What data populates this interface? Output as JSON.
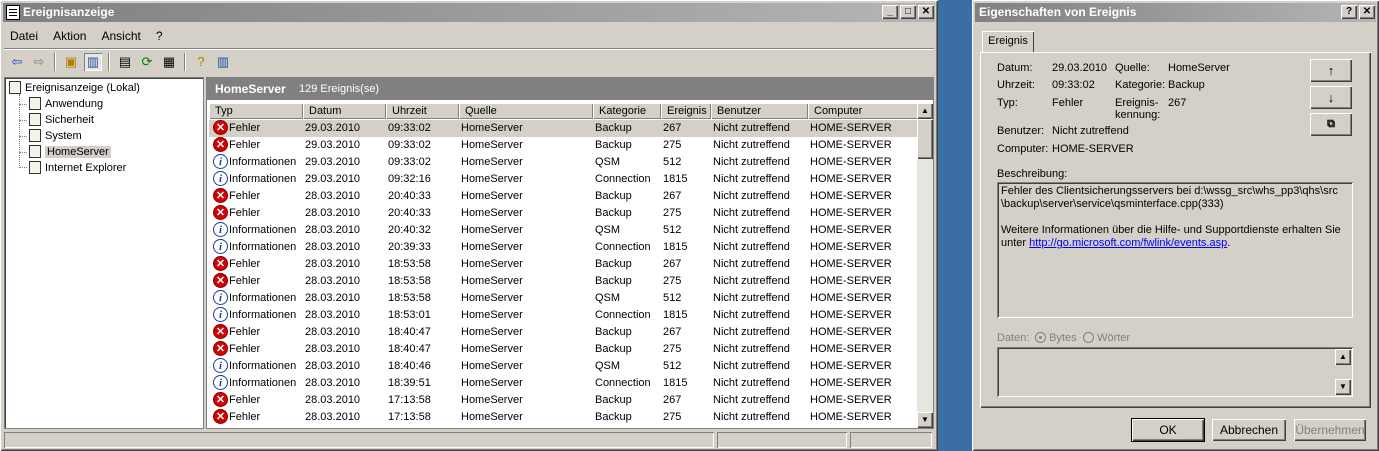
{
  "main": {
    "title": "Ereignisanzeige",
    "menu": [
      "Datei",
      "Aktion",
      "Ansicht",
      "?"
    ],
    "tree": {
      "root": "Ereignisanzeige (Lokal)",
      "items": [
        "Anwendung",
        "Sicherheit",
        "System",
        "HomeServer",
        "Internet Explorer"
      ],
      "selected": "HomeServer"
    },
    "pane_title": "HomeServer",
    "pane_count": "129 Ereignis(se)",
    "columns": [
      "Typ",
      "Datum",
      "Uhrzeit",
      "Quelle",
      "Kategorie",
      "Ereignis",
      "Benutzer",
      "Computer"
    ],
    "rows": [
      {
        "type": "err",
        "typ": "Fehler",
        "datum": "29.03.2010",
        "zeit": "09:33:02",
        "quelle": "HomeServer",
        "kat": "Backup",
        "ev": "267",
        "user": "Nicht zutreffend",
        "comp": "HOME-SERVER"
      },
      {
        "type": "err",
        "typ": "Fehler",
        "datum": "29.03.2010",
        "zeit": "09:33:02",
        "quelle": "HomeServer",
        "kat": "Backup",
        "ev": "275",
        "user": "Nicht zutreffend",
        "comp": "HOME-SERVER"
      },
      {
        "type": "inf",
        "typ": "Informationen",
        "datum": "29.03.2010",
        "zeit": "09:33:02",
        "quelle": "HomeServer",
        "kat": "QSM",
        "ev": "512",
        "user": "Nicht zutreffend",
        "comp": "HOME-SERVER"
      },
      {
        "type": "inf",
        "typ": "Informationen",
        "datum": "29.03.2010",
        "zeit": "09:32:16",
        "quelle": "HomeServer",
        "kat": "Connection",
        "ev": "1815",
        "user": "Nicht zutreffend",
        "comp": "HOME-SERVER"
      },
      {
        "type": "err",
        "typ": "Fehler",
        "datum": "28.03.2010",
        "zeit": "20:40:33",
        "quelle": "HomeServer",
        "kat": "Backup",
        "ev": "267",
        "user": "Nicht zutreffend",
        "comp": "HOME-SERVER"
      },
      {
        "type": "err",
        "typ": "Fehler",
        "datum": "28.03.2010",
        "zeit": "20:40:33",
        "quelle": "HomeServer",
        "kat": "Backup",
        "ev": "275",
        "user": "Nicht zutreffend",
        "comp": "HOME-SERVER"
      },
      {
        "type": "inf",
        "typ": "Informationen",
        "datum": "28.03.2010",
        "zeit": "20:40:32",
        "quelle": "HomeServer",
        "kat": "QSM",
        "ev": "512",
        "user": "Nicht zutreffend",
        "comp": "HOME-SERVER"
      },
      {
        "type": "inf",
        "typ": "Informationen",
        "datum": "28.03.2010",
        "zeit": "20:39:33",
        "quelle": "HomeServer",
        "kat": "Connection",
        "ev": "1815",
        "user": "Nicht zutreffend",
        "comp": "HOME-SERVER"
      },
      {
        "type": "err",
        "typ": "Fehler",
        "datum": "28.03.2010",
        "zeit": "18:53:58",
        "quelle": "HomeServer",
        "kat": "Backup",
        "ev": "267",
        "user": "Nicht zutreffend",
        "comp": "HOME-SERVER"
      },
      {
        "type": "err",
        "typ": "Fehler",
        "datum": "28.03.2010",
        "zeit": "18:53:58",
        "quelle": "HomeServer",
        "kat": "Backup",
        "ev": "275",
        "user": "Nicht zutreffend",
        "comp": "HOME-SERVER"
      },
      {
        "type": "inf",
        "typ": "Informationen",
        "datum": "28.03.2010",
        "zeit": "18:53:58",
        "quelle": "HomeServer",
        "kat": "QSM",
        "ev": "512",
        "user": "Nicht zutreffend",
        "comp": "HOME-SERVER"
      },
      {
        "type": "inf",
        "typ": "Informationen",
        "datum": "28.03.2010",
        "zeit": "18:53:01",
        "quelle": "HomeServer",
        "kat": "Connection",
        "ev": "1815",
        "user": "Nicht zutreffend",
        "comp": "HOME-SERVER"
      },
      {
        "type": "err",
        "typ": "Fehler",
        "datum": "28.03.2010",
        "zeit": "18:40:47",
        "quelle": "HomeServer",
        "kat": "Backup",
        "ev": "267",
        "user": "Nicht zutreffend",
        "comp": "HOME-SERVER"
      },
      {
        "type": "err",
        "typ": "Fehler",
        "datum": "28.03.2010",
        "zeit": "18:40:47",
        "quelle": "HomeServer",
        "kat": "Backup",
        "ev": "275",
        "user": "Nicht zutreffend",
        "comp": "HOME-SERVER"
      },
      {
        "type": "inf",
        "typ": "Informationen",
        "datum": "28.03.2010",
        "zeit": "18:40:46",
        "quelle": "HomeServer",
        "kat": "QSM",
        "ev": "512",
        "user": "Nicht zutreffend",
        "comp": "HOME-SERVER"
      },
      {
        "type": "inf",
        "typ": "Informationen",
        "datum": "28.03.2010",
        "zeit": "18:39:51",
        "quelle": "HomeServer",
        "kat": "Connection",
        "ev": "1815",
        "user": "Nicht zutreffend",
        "comp": "HOME-SERVER"
      },
      {
        "type": "err",
        "typ": "Fehler",
        "datum": "28.03.2010",
        "zeit": "17:13:58",
        "quelle": "HomeServer",
        "kat": "Backup",
        "ev": "267",
        "user": "Nicht zutreffend",
        "comp": "HOME-SERVER"
      },
      {
        "type": "err",
        "typ": "Fehler",
        "datum": "28.03.2010",
        "zeit": "17:13:58",
        "quelle": "HomeServer",
        "kat": "Backup",
        "ev": "275",
        "user": "Nicht zutreffend",
        "comp": "HOME-SERVER"
      }
    ]
  },
  "dialog": {
    "title": "Eigenschaften von Ereignis",
    "tab": "Ereignis",
    "labels": {
      "datum": "Datum:",
      "uhrzeit": "Uhrzeit:",
      "typ": "Typ:",
      "benutzer": "Benutzer:",
      "computer": "Computer:",
      "quelle": "Quelle:",
      "kategorie": "Kategorie:",
      "ereignis1": "Ereignis-",
      "ereignis2": "kennung:",
      "beschreibung": "Beschreibung:",
      "daten": "Daten:",
      "bytes": "Bytes",
      "woerter": "Wörter"
    },
    "values": {
      "datum": "29.03.2010",
      "uhrzeit": "09:33:02",
      "typ": "Fehler",
      "benutzer": "Nicht zutreffend",
      "computer": "HOME-SERVER",
      "quelle": "HomeServer",
      "kategorie": "Backup",
      "ereignis": "267"
    },
    "description": {
      "line1": "Fehler des Clientsicherungsservers bei d:\\wssg_src\\whs_pp3\\qhs\\src",
      "line2": "\\backup\\server\\service\\qsminterface.cpp(333)",
      "line3": "Weitere Informationen über die Hilfe- und Supportdienste erhalten Sie",
      "line4_prefix": "unter ",
      "link": "http://go.microsoft.com/fwlink/events.asp",
      "line4_suffix": "."
    },
    "buttons": {
      "ok": "OK",
      "cancel": "Abbrechen",
      "apply": "Übernehmen"
    }
  }
}
